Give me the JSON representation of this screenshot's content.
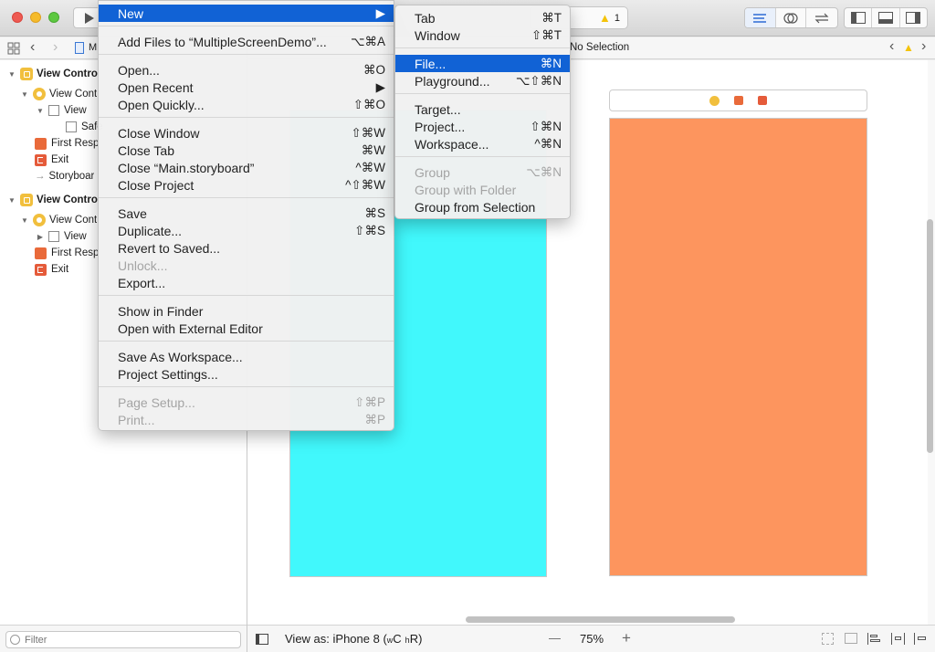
{
  "colors": {
    "highlight": "#1162d5",
    "scene_cyan": "#41f8fc",
    "scene_orange": "#fd955e",
    "close": "#ee5a52",
    "minimize": "#f5bb2b",
    "zoom": "#5dc840",
    "warning": "#f4c30b"
  },
  "toolbar": {
    "warning_count": "1",
    "icons": [
      "run-icon",
      "warning-icon",
      "standard-editor-icon",
      "assistant-editor-icon",
      "version-editor-icon",
      "navigator-toggle-icon",
      "debug-toggle-icon",
      "utilities-toggle-icon"
    ]
  },
  "navbar": {
    "file_label": "M"
  },
  "jumpbar": {
    "selection": "No Selection"
  },
  "navigator": {
    "rows": [
      {
        "label": "View Contro",
        "bold": true
      },
      {
        "label": "View Cont"
      },
      {
        "label": "View"
      },
      {
        "label": "Safe"
      },
      {
        "label": "First Resp"
      },
      {
        "label": "Exit"
      },
      {
        "label": "Storyboar"
      },
      {
        "label": "View Contro",
        "bold": true
      },
      {
        "label": "View Cont"
      },
      {
        "label": "View"
      },
      {
        "label": "First Resp"
      },
      {
        "label": "Exit"
      }
    ],
    "filter_placeholder": "Filter"
  },
  "canvas_footer": {
    "view_as": "View as: iPhone 8 (",
    "size_class_w": "w",
    "size_class_c": "C",
    "size_class_h": "h",
    "size_class_r": "R",
    "size_class_close": ")",
    "zoom_minus": "—",
    "zoom": "75%",
    "zoom_plus": "+"
  },
  "file_menu": {
    "new": {
      "label": "New",
      "arrow": "▶"
    },
    "add_files": {
      "label": "Add Files to “MultipleScreenDemo”...",
      "shortcut": "⌥⌘A"
    },
    "open": {
      "label": "Open...",
      "shortcut": "⌘O"
    },
    "open_recent": {
      "label": "Open Recent",
      "arrow": "▶"
    },
    "open_quickly": {
      "label": "Open Quickly...",
      "shortcut": "⇧⌘O"
    },
    "close_window": {
      "label": "Close Window",
      "shortcut": "⇧⌘W"
    },
    "close_tab": {
      "label": "Close Tab",
      "shortcut": "⌘W"
    },
    "close_file": {
      "label": "Close “Main.storyboard”",
      "shortcut": "^⌘W"
    },
    "close_project": {
      "label": "Close Project",
      "shortcut": "^⇧⌘W"
    },
    "save": {
      "label": "Save",
      "shortcut": "⌘S"
    },
    "duplicate": {
      "label": "Duplicate...",
      "shortcut": "⇧⌘S"
    },
    "revert": {
      "label": "Revert to Saved..."
    },
    "unlock": {
      "label": "Unlock..."
    },
    "export": {
      "label": "Export..."
    },
    "show_in_finder": {
      "label": "Show in Finder"
    },
    "open_external": {
      "label": "Open with External Editor"
    },
    "save_workspace": {
      "label": "Save As Workspace..."
    },
    "project_settings": {
      "label": "Project Settings..."
    },
    "page_setup": {
      "label": "Page Setup...",
      "shortcut": "⇧⌘P"
    },
    "print": {
      "label": "Print...",
      "shortcut": "⌘P"
    }
  },
  "new_menu": {
    "tab": {
      "label": "Tab",
      "shortcut": "⌘T"
    },
    "window": {
      "label": "Window",
      "shortcut": "⇧⌘T"
    },
    "file": {
      "label": "File...",
      "shortcut": "⌘N"
    },
    "playground": {
      "label": "Playground...",
      "shortcut": "⌥⇧⌘N"
    },
    "target": {
      "label": "Target..."
    },
    "project": {
      "label": "Project...",
      "shortcut": "⇧⌘N"
    },
    "workspace": {
      "label": "Workspace...",
      "shortcut": "^⌘N"
    },
    "group": {
      "label": "Group",
      "shortcut": "⌥⌘N"
    },
    "group_folder": {
      "label": "Group with Folder"
    },
    "group_selection": {
      "label": "Group from Selection"
    }
  }
}
